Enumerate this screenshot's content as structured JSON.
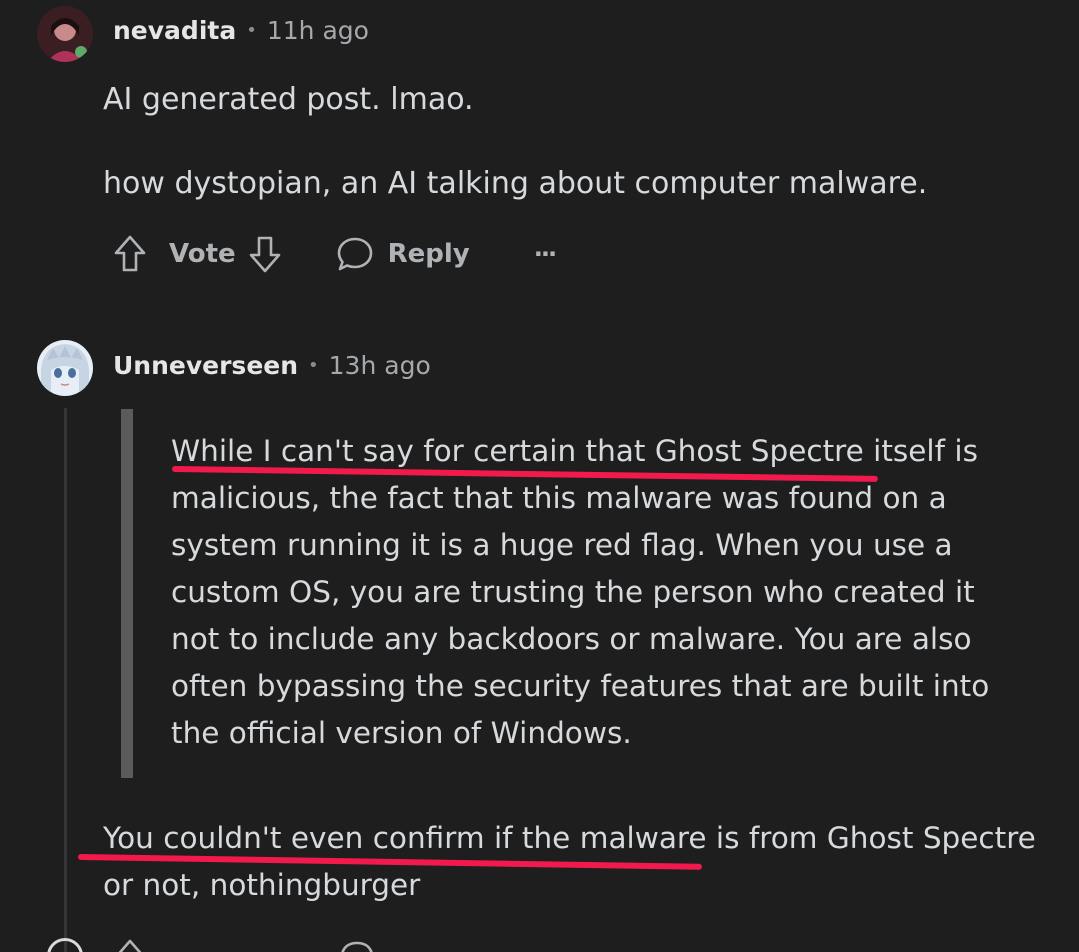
{
  "comments": [
    {
      "username": "nevadita",
      "separator": "•",
      "time": "11h ago",
      "paragraphs": [
        "AI generated post. lmao.",
        "how dystopian, an AI talking about computer malware."
      ],
      "actions": {
        "vote_label": "Vote",
        "reply_label": "Reply",
        "more_label": "···"
      }
    },
    {
      "username": "Unneverseen",
      "separator": "•",
      "time": "13h ago",
      "quote_lines": [
        "While I can't say for certain that Ghost Spectre itself is",
        "malicious, the fact that this malware was found on a",
        "system running it is a huge red flag. When you use a",
        "custom OS, you are trusting the person who created it",
        "not to include any backdoors or malware. You are also",
        "often bypassing the security features that are built into",
        "the official version of Windows."
      ],
      "reply_lines": [
        "You couldn't even confirm if the malware is from Ghost Spectre",
        "or not, nothingburger"
      ]
    }
  ],
  "colors": {
    "background": "#1e1e1f",
    "text": "#d7dadc",
    "highlight": "#f2194c"
  }
}
